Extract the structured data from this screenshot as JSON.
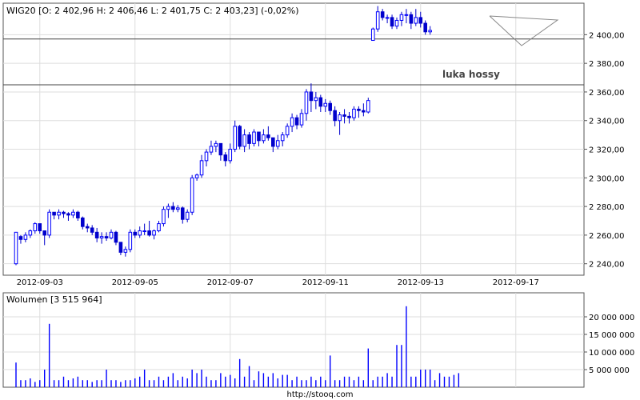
{
  "header": {
    "quote": "WIG20 [O: 2 402,96  H: 2 406,46  L: 2 401,75  C: 2 403,23] (-0,02%)",
    "volume": "Wolumen [3 515 964]",
    "footer": "http://stooq.com",
    "note": "luka hossy"
  },
  "colors": {
    "up": "#0000ff",
    "down": "#0000cc",
    "grid": "#dddddd",
    "frame": "#555555",
    "line": "#444444"
  },
  "chart_data": [
    {
      "type": "candlestick",
      "title": "WIG20 [O: 2 402,96  H: 2 406,46  L: 2 401,75  C: 2 403,23] (-0,02%)",
      "ylim": [
        2232,
        2422
      ],
      "yticks": [
        2240,
        2260,
        2280,
        2300,
        2320,
        2340,
        2360,
        2380,
        2400
      ],
      "ytick_labels": [
        "2 240,00",
        "2 260,00",
        "2 280,00",
        "2 300,00",
        "2 320,00",
        "2 340,00",
        "2 360,00",
        "2 380,00",
        "2 400,00"
      ],
      "xtick_labels": [
        "2012-09-03",
        "2012-09-05",
        "2012-09-07",
        "2012-09-11",
        "2012-09-13",
        "2012-09-17"
      ],
      "xtick_index": [
        5,
        25,
        45,
        65,
        85,
        105
      ],
      "horizontal_levels": [
        2397,
        2365
      ],
      "candles": [
        [
          2240,
          2262,
          2239,
          2262
        ],
        [
          2259,
          2260,
          2254,
          2257
        ],
        [
          2257,
          2262,
          2255,
          2260
        ],
        [
          2260,
          2264,
          2258,
          2263
        ],
        [
          2263,
          2269,
          2261,
          2268
        ],
        [
          2268,
          2266,
          2261,
          2263
        ],
        [
          2263,
          2263,
          2253,
          2260
        ],
        [
          2260,
          2278,
          2258,
          2276
        ],
        [
          2276,
          2276,
          2271,
          2274
        ],
        [
          2274,
          2278,
          2271,
          2276
        ],
        [
          2276,
          2277,
          2272,
          2275
        ],
        [
          2275,
          2276,
          2270,
          2274
        ],
        [
          2274,
          2278,
          2272,
          2276
        ],
        [
          2276,
          2277,
          2270,
          2272
        ],
        [
          2272,
          2273,
          2264,
          2266
        ],
        [
          2266,
          2268,
          2262,
          2265
        ],
        [
          2265,
          2267,
          2260,
          2262
        ],
        [
          2262,
          2265,
          2255,
          2258
        ],
        [
          2258,
          2262,
          2254,
          2259
        ],
        [
          2259,
          2262,
          2256,
          2258
        ],
        [
          2258,
          2264,
          2257,
          2262
        ],
        [
          2262,
          2263,
          2253,
          2255
        ],
        [
          2255,
          2254,
          2246,
          2248
        ],
        [
          2248,
          2252,
          2245,
          2250
        ],
        [
          2250,
          2264,
          2248,
          2262
        ],
        [
          2262,
          2264,
          2258,
          2260
        ],
        [
          2260,
          2266,
          2258,
          2263
        ],
        [
          2263,
          2268,
          2260,
          2263
        ],
        [
          2263,
          2270,
          2259,
          2260
        ],
        [
          2260,
          2264,
          2257,
          2263
        ],
        [
          2263,
          2270,
          2262,
          2268
        ],
        [
          2268,
          2280,
          2266,
          2278
        ],
        [
          2278,
          2282,
          2272,
          2280
        ],
        [
          2280,
          2283,
          2276,
          2278
        ],
        [
          2278,
          2281,
          2276,
          2279
        ],
        [
          2279,
          2280,
          2268,
          2271
        ],
        [
          2271,
          2278,
          2269,
          2276
        ],
        [
          2276,
          2302,
          2274,
          2300
        ],
        [
          2300,
          2303,
          2298,
          2302
        ],
        [
          2302,
          2316,
          2300,
          2312
        ],
        [
          2312,
          2320,
          2308,
          2318
        ],
        [
          2318,
          2326,
          2316,
          2322
        ],
        [
          2322,
          2326,
          2318,
          2324
        ],
        [
          2324,
          2322,
          2312,
          2316
        ],
        [
          2316,
          2318,
          2308,
          2312
        ],
        [
          2312,
          2324,
          2310,
          2320
        ],
        [
          2320,
          2340,
          2318,
          2336
        ],
        [
          2336,
          2337,
          2320,
          2322
        ],
        [
          2322,
          2334,
          2318,
          2330
        ],
        [
          2330,
          2332,
          2320,
          2324
        ],
        [
          2324,
          2334,
          2322,
          2332
        ],
        [
          2332,
          2330,
          2322,
          2326
        ],
        [
          2326,
          2334,
          2324,
          2330
        ],
        [
          2330,
          2336,
          2326,
          2328
        ],
        [
          2328,
          2326,
          2318,
          2322
        ],
        [
          2322,
          2330,
          2320,
          2326
        ],
        [
          2326,
          2332,
          2322,
          2330
        ],
        [
          2330,
          2338,
          2328,
          2336
        ],
        [
          2336,
          2345,
          2332,
          2342
        ],
        [
          2342,
          2344,
          2334,
          2337
        ],
        [
          2337,
          2348,
          2335,
          2345
        ],
        [
          2345,
          2362,
          2340,
          2360
        ],
        [
          2360,
          2366,
          2346,
          2354
        ],
        [
          2354,
          2360,
          2348,
          2356
        ],
        [
          2356,
          2358,
          2346,
          2350
        ],
        [
          2350,
          2355,
          2346,
          2352
        ],
        [
          2352,
          2354,
          2344,
          2347
        ],
        [
          2347,
          2350,
          2336,
          2340
        ],
        [
          2340,
          2346,
          2330,
          2344
        ],
        [
          2344,
          2348,
          2338,
          2343
        ],
        [
          2343,
          2346,
          2338,
          2342
        ],
        [
          2342,
          2350,
          2340,
          2348
        ],
        [
          2348,
          2350,
          2342,
          2347
        ],
        [
          2347,
          2352,
          2343,
          2346
        ],
        [
          2346,
          2356,
          2345,
          2354
        ],
        [
          2396,
          2405,
          2396,
          2404
        ],
        [
          2404,
          2420,
          2402,
          2416
        ],
        [
          2416,
          2418,
          2410,
          2412
        ],
        [
          2412,
          2414,
          2408,
          2412
        ],
        [
          2412,
          2414,
          2404,
          2406
        ],
        [
          2406,
          2412,
          2404,
          2410
        ],
        [
          2410,
          2416,
          2406,
          2414
        ],
        [
          2414,
          2418,
          2408,
          2414
        ],
        [
          2414,
          2416,
          2404,
          2408
        ],
        [
          2408,
          2418,
          2406,
          2412
        ],
        [
          2412,
          2416,
          2405,
          2408
        ],
        [
          2408,
          2410,
          2400,
          2402
        ],
        [
          2402,
          2406,
          2400,
          2403
        ]
      ]
    },
    {
      "type": "bar",
      "title": "Wolumen [3 515 964]",
      "ylim": [
        0,
        25000000
      ],
      "yticks": [
        5000000,
        10000000,
        15000000,
        20000000
      ],
      "ytick_labels": [
        "5 000 000",
        "10 000 000",
        "15 000 000",
        "20 000 000"
      ],
      "values": [
        7000000,
        2000000,
        2000000,
        2500000,
        1500000,
        2000000,
        5000000,
        18000000,
        2000000,
        2000000,
        3000000,
        2000000,
        2500000,
        3000000,
        2000000,
        2000000,
        1500000,
        2000000,
        2000000,
        5000000,
        2000000,
        2000000,
        1500000,
        2000000,
        2000000,
        2500000,
        3000000,
        5000000,
        2000000,
        2000000,
        3000000,
        2000000,
        3000000,
        4000000,
        2000000,
        3000000,
        2500000,
        5000000,
        4000000,
        5000000,
        3000000,
        2000000,
        2000000,
        4000000,
        3000000,
        3500000,
        2500000,
        8000000,
        3000000,
        6000000,
        2000000,
        4500000,
        4000000,
        3000000,
        4000000,
        2500000,
        3500000,
        3500000,
        2000000,
        3000000,
        2000000,
        2000000,
        3000000,
        2000000,
        3000000,
        2000000,
        9000000,
        2000000,
        2000000,
        3000000,
        3000000,
        2000000,
        3000000,
        2000000,
        11000000,
        2000000,
        3000000,
        3000000,
        4000000,
        3000000,
        12000000,
        12000000,
        23000000,
        3000000,
        3000000,
        5000000,
        5000000,
        5000000,
        2000000,
        4000000,
        3000000,
        3000000,
        3500000,
        4000000
      ]
    }
  ]
}
